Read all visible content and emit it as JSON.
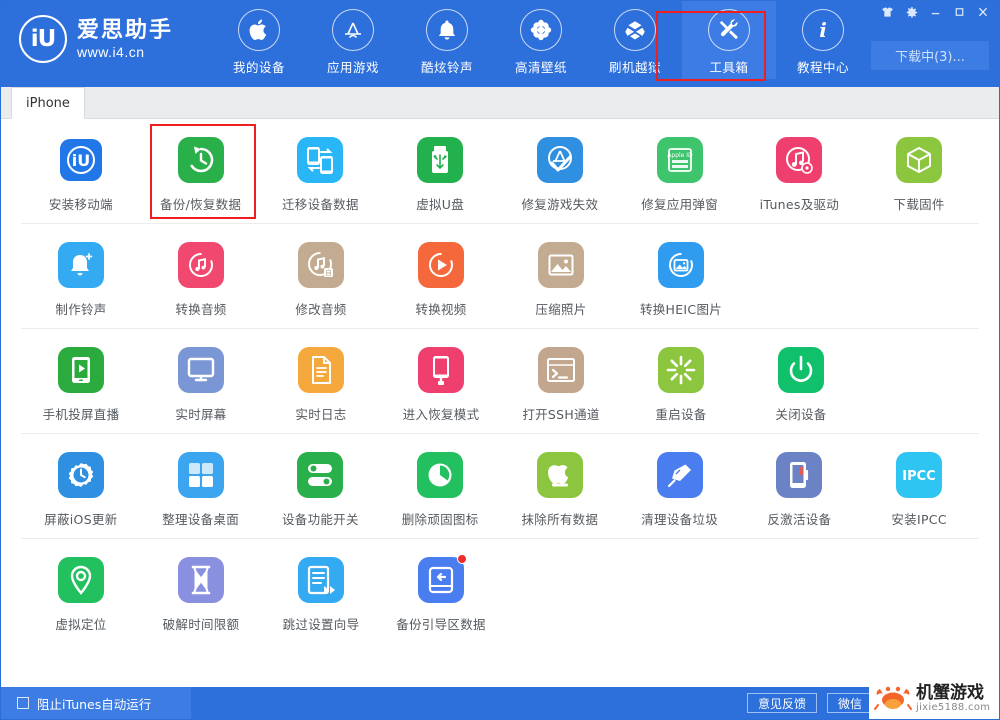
{
  "brand": {
    "name_cn": "爱思助手",
    "url": "www.i4.cn",
    "logo_text": "iU"
  },
  "window_controls": [
    {
      "name": "skin-icon",
      "glyph": "shirt"
    },
    {
      "name": "settings-icon",
      "glyph": "gear"
    },
    {
      "name": "minimize-icon",
      "glyph": "minimize"
    },
    {
      "name": "maximize-icon",
      "glyph": "maximize"
    },
    {
      "name": "close-icon",
      "glyph": "close"
    }
  ],
  "header": {
    "download_button": "下载中(3)...",
    "nav": [
      {
        "label": "我的设备",
        "icon": "apple-icon",
        "active": false
      },
      {
        "label": "应用游戏",
        "icon": "appstore-icon",
        "active": false
      },
      {
        "label": "酷炫铃声",
        "icon": "bell-icon",
        "active": false
      },
      {
        "label": "高清壁纸",
        "icon": "flower-icon",
        "active": false
      },
      {
        "label": "刷机越狱",
        "icon": "box-icon",
        "active": false
      },
      {
        "label": "工具箱",
        "icon": "tools-icon",
        "active": true
      },
      {
        "label": "教程中心",
        "icon": "info-icon",
        "active": false
      }
    ],
    "highlighted_nav": "工具箱"
  },
  "tabs": [
    {
      "label": "iPhone",
      "active": true
    }
  ],
  "highlighted_tool": "备份/恢复数据",
  "tool_rows": [
    [
      {
        "label": "安装移动端",
        "icon": "i4-app-icon",
        "bg": "#ffffff",
        "fg": "#2176e8",
        "badge": false
      },
      {
        "label": "备份/恢复数据",
        "icon": "backup-restore-icon",
        "bg": "#2ab04a",
        "fg": "#ffffff",
        "badge": false,
        "highlight": true
      },
      {
        "label": "迁移设备数据",
        "icon": "device-migrate-icon",
        "bg": "#29b6f6",
        "fg": "#ffffff",
        "badge": false
      },
      {
        "label": "虚拟U盘",
        "icon": "usb-drive-icon",
        "bg": "#22b14c",
        "fg": "#ffffff",
        "badge": false
      },
      {
        "label": "修复游戏失效",
        "icon": "appstore-fix-icon",
        "bg": "#2f8fe0",
        "fg": "#ffffff",
        "badge": false
      },
      {
        "label": "修复应用弹窗",
        "icon": "appleid-icon",
        "bg": "#3ec46d",
        "fg": "#ffffff",
        "badge": false
      },
      {
        "label": "iTunes及驱动",
        "icon": "itunes-gear-icon",
        "bg": "#ef3f6e",
        "fg": "#ffffff",
        "badge": false
      },
      {
        "label": "下载固件",
        "icon": "firmware-box-icon",
        "bg": "#8cc63f",
        "fg": "#ffffff",
        "badge": false
      }
    ],
    [
      {
        "label": "制作铃声",
        "icon": "ringtone-bell-icon",
        "bg": "#34aaf2",
        "fg": "#ffffff",
        "badge": false
      },
      {
        "label": "转换音频",
        "icon": "audio-convert-icon",
        "bg": "#f0486f",
        "fg": "#ffffff",
        "badge": false
      },
      {
        "label": "修改音频",
        "icon": "audio-edit-icon",
        "bg": "#c2ab90",
        "fg": "#ffffff",
        "badge": false
      },
      {
        "label": "转换视频",
        "icon": "video-convert-icon",
        "bg": "#f4683c",
        "fg": "#ffffff",
        "badge": false
      },
      {
        "label": "压缩照片",
        "icon": "photo-compress-icon",
        "bg": "#c2ab90",
        "fg": "#ffffff",
        "badge": false
      },
      {
        "label": "转换HEIC图片",
        "icon": "heic-convert-icon",
        "bg": "#2f9cf0",
        "fg": "#ffffff",
        "badge": false
      }
    ],
    [
      {
        "label": "手机投屏直播",
        "icon": "screen-cast-icon",
        "bg": "#2bab3e",
        "fg": "#ffffff",
        "badge": false
      },
      {
        "label": "实时屏幕",
        "icon": "monitor-icon",
        "bg": "#7b96d4",
        "fg": "#ffffff",
        "badge": false
      },
      {
        "label": "实时日志",
        "icon": "log-file-icon",
        "bg": "#f5a93c",
        "fg": "#ffffff",
        "badge": false
      },
      {
        "label": "进入恢复模式",
        "icon": "recovery-mode-icon",
        "bg": "#ef3f6e",
        "fg": "#ffffff",
        "badge": false
      },
      {
        "label": "打开SSH通道",
        "icon": "ssh-terminal-icon",
        "bg": "#c2a68d",
        "fg": "#ffffff",
        "badge": false
      },
      {
        "label": "重启设备",
        "icon": "restart-icon",
        "bg": "#8cc63f",
        "fg": "#ffffff",
        "badge": false
      },
      {
        "label": "关闭设备",
        "icon": "power-off-icon",
        "bg": "#11c06b",
        "fg": "#ffffff",
        "badge": false
      }
    ],
    [
      {
        "label": "屏蔽iOS更新",
        "icon": "block-update-icon",
        "bg": "#2f8fe0",
        "fg": "#ffffff",
        "badge": false
      },
      {
        "label": "整理设备桌面",
        "icon": "organize-apps-icon",
        "bg": "#3ca5f0",
        "fg": "#ffffff",
        "badge": false
      },
      {
        "label": "设备功能开关",
        "icon": "toggles-icon",
        "bg": "#2ab04a",
        "fg": "#ffffff",
        "badge": false
      },
      {
        "label": "删除顽固图标",
        "icon": "delete-icon-icon",
        "bg": "#22c05e",
        "fg": "#ffffff",
        "badge": false
      },
      {
        "label": "抹除所有数据",
        "icon": "erase-apple-icon",
        "bg": "#8cc63f",
        "fg": "#ffffff",
        "badge": false
      },
      {
        "label": "清理设备垃圾",
        "icon": "clean-broom-icon",
        "bg": "#4a7ef0",
        "fg": "#ffffff",
        "badge": false
      },
      {
        "label": "反激活设备",
        "icon": "deactivate-icon",
        "bg": "#6b82c4",
        "fg": "#ffffff",
        "badge": false
      },
      {
        "label": "安装IPCC",
        "icon": "ipcc-icon",
        "bg": "#2fc5f2",
        "fg": "#ffffff",
        "badge": false
      }
    ],
    [
      {
        "label": "虚拟定位",
        "icon": "location-pin-icon",
        "bg": "#22c05e",
        "fg": "#ffffff",
        "badge": false
      },
      {
        "label": "破解时间限额",
        "icon": "hourglass-icon",
        "bg": "#8a90e0",
        "fg": "#ffffff",
        "badge": false
      },
      {
        "label": "跳过设置向导",
        "icon": "skip-setup-icon",
        "bg": "#34aaf2",
        "fg": "#ffffff",
        "badge": false
      },
      {
        "label": "备份引导区数据",
        "icon": "backup-boot-icon",
        "bg": "#4a7ef0",
        "fg": "#ffffff",
        "badge": true
      }
    ]
  ],
  "bottom": {
    "checkbox_label": "阻止iTunes自动运行",
    "checkbox_checked": false,
    "buttons": [
      {
        "label": "意见反馈"
      },
      {
        "label": "微信"
      }
    ]
  },
  "watermark": {
    "title": "机蟹游戏",
    "url": "jixie5188.com"
  },
  "colors": {
    "header_blue": "#2d6fdb",
    "header_blue_light": "#3c7ce3",
    "highlight_red": "#f01f1f",
    "text_dark": "#555a60"
  }
}
